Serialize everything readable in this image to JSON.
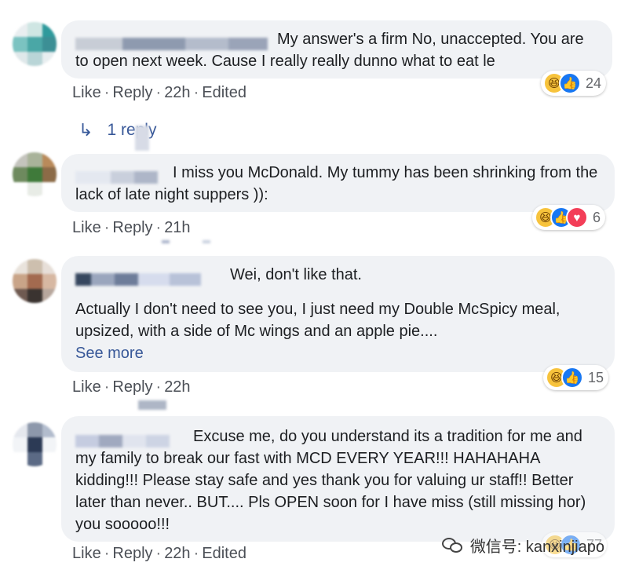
{
  "comments": [
    {
      "text": "My answer's a firm No, unaccepted. You are to open next week. Cause I really really dunno what to eat le",
      "actions": {
        "like": "Like",
        "reply": "Reply",
        "time": "22h",
        "edited": "Edited"
      },
      "reaction_count": "24"
    },
    {
      "text": "I miss you McDonald. My tummy has been shrinking from the lack of late night suppers )):",
      "actions": {
        "like": "Like",
        "reply": "Reply",
        "time": "21h"
      },
      "reaction_count": "6"
    },
    {
      "text_line1": "Wei, don't like that.",
      "text_line2": "Actually I don't need to see you, I just need my Double McSpicy meal, upsized, with a side of Mc wings and an apple pie....",
      "see_more": "See more",
      "actions": {
        "like": "Like",
        "reply": "Reply",
        "time": "22h"
      },
      "reaction_count": "15"
    },
    {
      "text": "Excuse me, do you understand its a tradition for me and my family to break our fast with MCD EVERY YEAR!!! HAHAHAHA kidding!!! Please stay safe and yes thank you for valuing ur staff!! Better later than never.. BUT.... Pls OPEN soon for I have miss (still missing hor) you sooooo!!!",
      "actions": {
        "like": "Like",
        "reply": "Reply",
        "time": "22h",
        "edited": "Edited"
      },
      "reaction_count": "77"
    }
  ],
  "replies_link": "1 reply",
  "watermark": "微信号: kanxinjiapo",
  "icons": {
    "haha": "haha-reaction-icon",
    "like": "like-reaction-icon",
    "love": "love-reaction-icon",
    "reply_arrow": "reply-arrow-icon",
    "wechat": "wechat-icon"
  },
  "colors": {
    "bubble": "#f0f2f5",
    "link": "#385898",
    "meta": "#65676b",
    "like": "#1877f2",
    "haha": "#f7c33c",
    "love": "#f33e58"
  }
}
